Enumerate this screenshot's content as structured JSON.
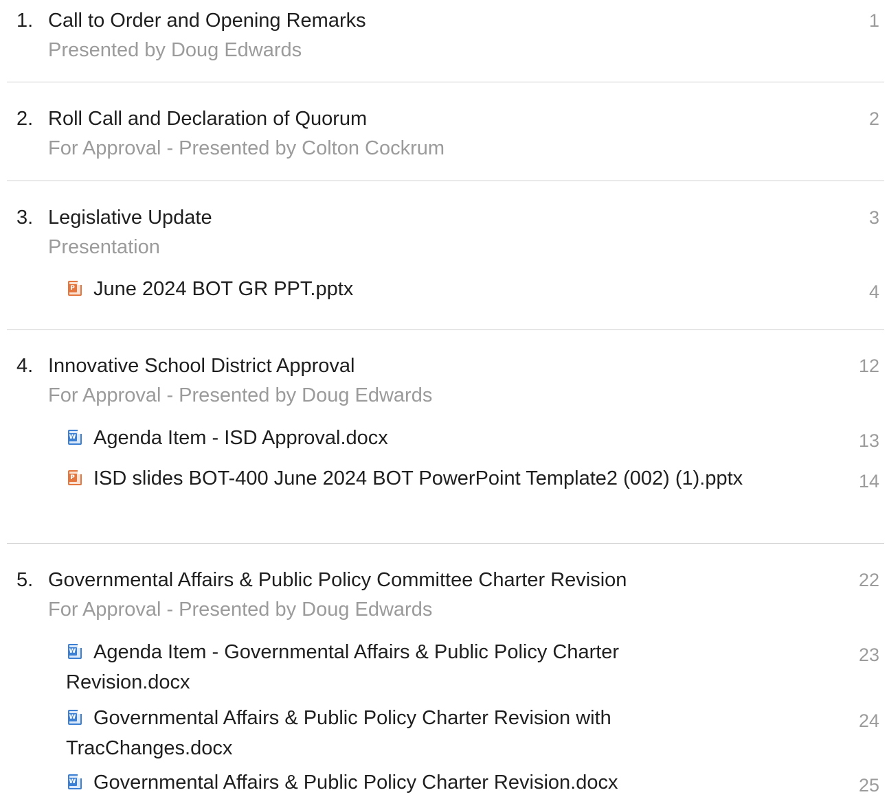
{
  "items": [
    {
      "number": "1.",
      "title": "Call to Order and Opening Remarks",
      "subtitle": "Presented by Doug Edwards",
      "page": "1"
    },
    {
      "number": "2.",
      "title": "Roll Call and Declaration of Quorum",
      "subtitle": "For Approval - Presented by Colton Cockrum",
      "page": "2"
    },
    {
      "number": "3.",
      "title": "Legislative Update",
      "subtitle": "Presentation",
      "page": "3",
      "attachments": [
        {
          "icon": "powerpoint-file-icon",
          "name": "June 2024 BOT GR PPT.pptx",
          "page": "4"
        }
      ]
    },
    {
      "number": "4.",
      "title": "Innovative School District Approval",
      "subtitle": "For Approval - Presented by Doug Edwards",
      "page": "12",
      "attachments": [
        {
          "icon": "word-file-icon",
          "name": "Agenda Item - ISD Approval.docx",
          "page": "13"
        },
        {
          "icon": "powerpoint-file-icon",
          "name": "ISD slides BOT-400 June 2024 BOT PowerPoint Template2 (002) (1).pptx",
          "page": "14"
        }
      ]
    },
    {
      "number": "5.",
      "title": "Governmental Affairs & Public Policy Committee Charter Revision",
      "subtitle": "For Approval - Presented by Doug Edwards",
      "page": "22",
      "attachments": [
        {
          "icon": "word-file-icon",
          "name": "Agenda Item - Governmental Affairs & Public Policy Charter Revision.docx",
          "page": "23"
        },
        {
          "icon": "word-file-icon",
          "name": "Governmental Affairs & Public Policy Charter Revision with TracChanges.docx",
          "page": "24"
        },
        {
          "icon": "word-file-icon",
          "name": "Governmental Affairs & Public Policy Charter Revision.docx",
          "page": "25"
        }
      ]
    }
  ]
}
